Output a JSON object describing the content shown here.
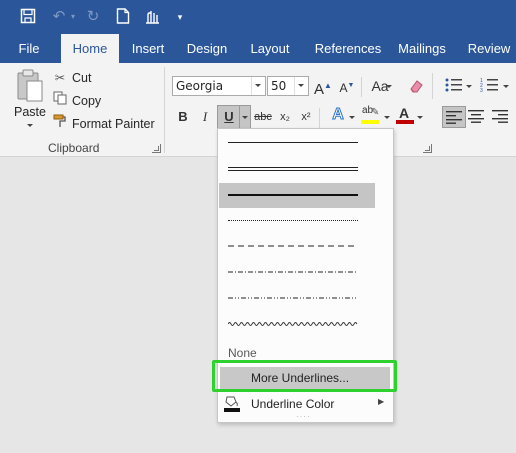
{
  "quick_access": {
    "icons": [
      "save-icon",
      "undo-icon",
      "redo-icon",
      "new-document-icon",
      "touch-mode-icon",
      "customize-icon"
    ]
  },
  "tabs": [
    {
      "label": "File"
    },
    {
      "label": "Home"
    },
    {
      "label": "Insert"
    },
    {
      "label": "Design"
    },
    {
      "label": "Layout"
    },
    {
      "label": "References"
    },
    {
      "label": "Mailings"
    },
    {
      "label": "Review"
    }
  ],
  "active_tab": "Home",
  "clipboard": {
    "paste_label": "Paste",
    "cut_label": "Cut",
    "copy_label": "Copy",
    "format_painter_label": "Format Painter",
    "group_label": "Clipboard"
  },
  "font": {
    "family_value": "Georgia",
    "size_value": "50",
    "bold_label": "B",
    "italic_label": "I",
    "underline_label": "U",
    "strike_label": "abc",
    "subscript_label": "x₂",
    "superscript_label": "x²",
    "grow_label": "A",
    "shrink_label": "A",
    "case_label": "Aa",
    "highlight_label": "ab"
  },
  "underline_menu": {
    "styles": [
      "single",
      "double",
      "thick",
      "dotted",
      "dashed",
      "dot-dash",
      "dot-dot-dash",
      "wave"
    ],
    "selected_index": 2,
    "none_label": "None",
    "more_label": "More Underlines...",
    "color_label": "Underline Color"
  },
  "colors": {
    "brand_blue": "#2b579a",
    "highlight_green": "#2ed12e",
    "font_color_red": "#c00000",
    "highlight_yellow": "#ffff00"
  }
}
